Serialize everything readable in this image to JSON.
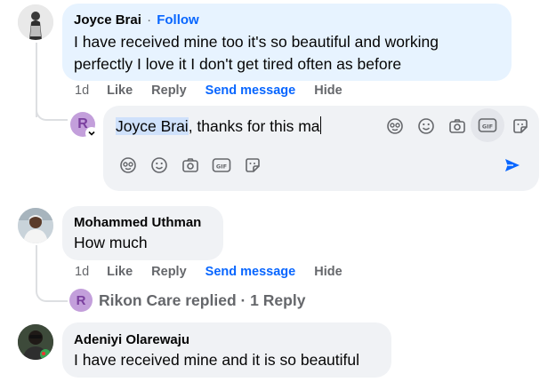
{
  "comments": [
    {
      "author": "Joyce Brai",
      "follow_label": "Follow",
      "separator": "·",
      "lines": [
        "I have received mine too it's so beautiful and working",
        "perfectly I love it I don't get tired often as before"
      ],
      "time": "1d",
      "like": "Like",
      "reply": "Reply",
      "send_message": "Send message",
      "hide": "Hide"
    },
    {
      "author": "Mohammed Uthman",
      "lines": [
        "How much"
      ],
      "time": "1d",
      "like": "Like",
      "reply": "Reply",
      "send_message": "Send message",
      "hide": "Hide"
    },
    {
      "author": "Adeniyi Olarewaju",
      "lines": [
        "I have received mine and it is so beautiful"
      ]
    }
  ],
  "reply_composer": {
    "avatar_letter": "R",
    "mention": "Joyce Brai",
    "typed_text": ", thanks for this ma"
  },
  "replies_summary": {
    "avatar_letter": "R",
    "text": "Rikon Care replied · 1 Reply"
  },
  "icons": {
    "top_row": [
      "avatar-sticker-icon",
      "emoji-icon",
      "camera-icon",
      "gif-icon",
      "sticker-icon"
    ],
    "bottom_row": [
      "avatar-sticker-icon",
      "emoji-icon",
      "camera-icon",
      "gif-icon",
      "sticker-icon"
    ],
    "send": "send-icon"
  },
  "colors": {
    "bubble_bg": "#f0f2f5",
    "highlight_bubble_bg": "#e7f3ff",
    "link_blue": "#0866ff",
    "meta_gray": "#65676b",
    "mention_highlight": "#cfe1fb",
    "r_avatar": "#c39fdb"
  }
}
